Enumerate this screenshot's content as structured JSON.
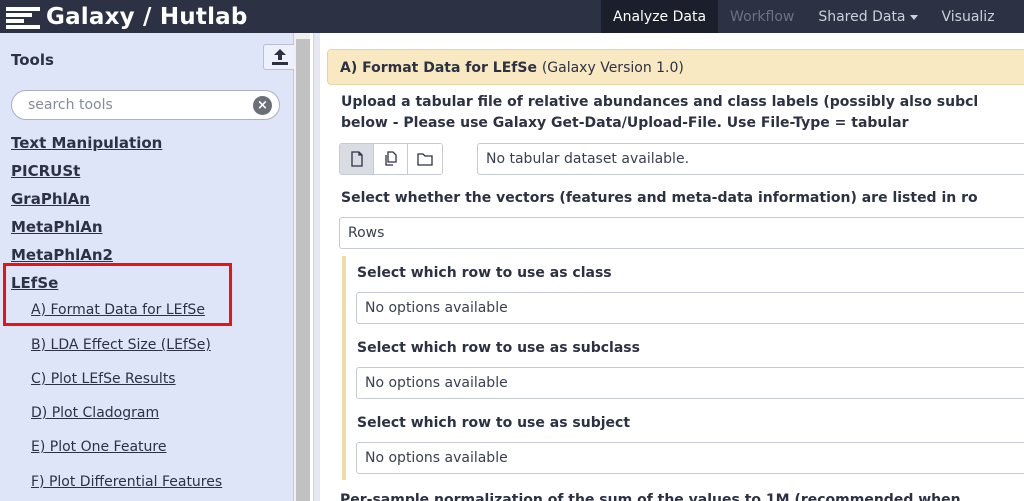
{
  "masthead": {
    "title": "Galaxy / Hutlab",
    "nav": [
      {
        "label": "Analyze Data"
      },
      {
        "label": "Workflow"
      },
      {
        "label": "Shared Data"
      },
      {
        "label": "Visualiz"
      }
    ]
  },
  "tool_panel": {
    "title": "Tools",
    "search": {
      "placeholder": "search tools",
      "value": ""
    },
    "sections": [
      {
        "label": "Text Manipulation"
      },
      {
        "label": "PICRUSt"
      },
      {
        "label": "GraPhlAn"
      },
      {
        "label": "MetaPhlAn"
      },
      {
        "label": "MetaPhlAn2"
      },
      {
        "label": "LEfSe"
      }
    ],
    "lefse_tools": [
      {
        "label": "A) Format Data for LEfSe"
      },
      {
        "label": "B) LDA Effect Size (LEfSe)"
      },
      {
        "label": "C) Plot LEfSe Results"
      },
      {
        "label": "D) Plot Cladogram"
      },
      {
        "label": "E) Plot One Feature"
      },
      {
        "label": "F) Plot Differential Features"
      }
    ]
  },
  "form": {
    "title": "A) Format Data for LEfSe",
    "version": "(Galaxy Version 1.0)",
    "upload_label_line1": "Upload a tabular file of relative abundances and class labels (possibly also subcl",
    "upload_label_line2": "below - Please use Galaxy Get-Data/Upload-File. Use File-Type = tabular",
    "dataset_value": "No tabular dataset available.",
    "vectors_label": "Select whether the vectors (features and meta-data information) are listed in ro",
    "vectors_value": "Rows",
    "class_label": "Select which row to use as class",
    "class_value": "No options available",
    "subclass_label": "Select which row to use as subclass",
    "subclass_value": "No options available",
    "subject_label": "Select which row to use as subject",
    "subject_value": "No options available",
    "bottom_text": "Per-sample normalization of the sum of the values to 1M (recommended when"
  }
}
